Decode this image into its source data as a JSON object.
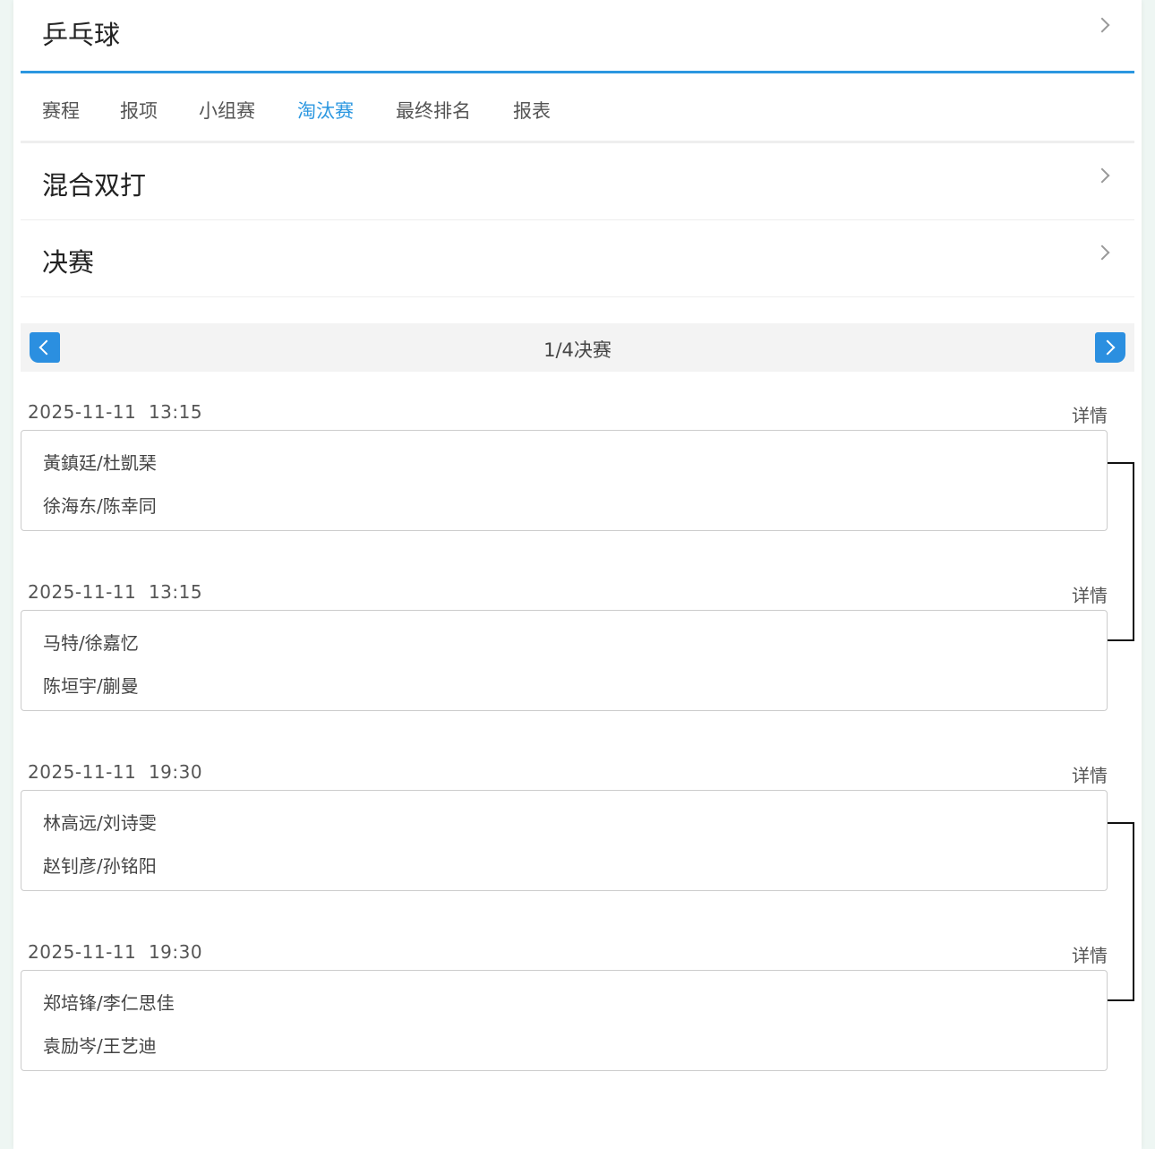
{
  "header": {
    "sport": "乒乓球"
  },
  "tabs": [
    {
      "label": "赛程"
    },
    {
      "label": "报项"
    },
    {
      "label": "小组赛"
    },
    {
      "label": "淘汰赛"
    },
    {
      "label": "最终排名"
    },
    {
      "label": "报表"
    }
  ],
  "active_tab": "淘汰赛",
  "event": {
    "name": "混合双打"
  },
  "stage": {
    "name": "决赛"
  },
  "round": {
    "title": "1/4决赛"
  },
  "matches": [
    {
      "time": "2025-11-11  13:15",
      "detail_label": "详情",
      "team1": "黃鎮廷/杜凱琹",
      "team2": "徐海东/陈幸同"
    },
    {
      "time": "2025-11-11  13:15",
      "detail_label": "详情",
      "team1": "马特/徐嘉忆",
      "team2": "陈垣宇/蒯曼"
    },
    {
      "time": "2025-11-11  19:30",
      "detail_label": "详情",
      "team1": "林高远/刘诗雯",
      "team2": "赵钊彦/孙铭阳"
    },
    {
      "time": "2025-11-11  19:30",
      "detail_label": "详情",
      "team1": "郑培锋/李仁思佳",
      "team2": "袁励岑/王艺迪"
    }
  ],
  "colors": {
    "accent": "#2b97e0",
    "nav_button": "#2b8fe0"
  },
  "icons": {
    "row_chevron": "chevron-right-icon",
    "prev": "chevron-left-icon",
    "next": "chevron-right-icon"
  }
}
